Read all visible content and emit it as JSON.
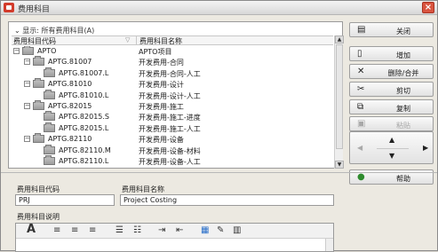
{
  "window": {
    "title": "费用科目",
    "close_glyph": "×"
  },
  "list": {
    "show_all": "⌄ 显示: 所有费用科目(A)",
    "col_code": "费用科目代码",
    "col_name": "费用科目名称",
    "rows": [
      {
        "exp": "−",
        "code": "APTO",
        "name": "APTO项目"
      },
      {
        "exp": "−",
        "code": "APTG.81007",
        "name": "开发费用-合同"
      },
      {
        "exp": "",
        "code": "APTG.81007.L",
        "name": "开发费用-合同-人工"
      },
      {
        "exp": "−",
        "code": "APTG.81010",
        "name": "开发费用-设计"
      },
      {
        "exp": "",
        "code": "APTG.81010.L",
        "name": "开发费用-设计-人工"
      },
      {
        "exp": "−",
        "code": "APTG.82015",
        "name": "开发费用-施工"
      },
      {
        "exp": "",
        "code": "APTG.82015.S",
        "name": "开发费用-施工-进度"
      },
      {
        "exp": "",
        "code": "APTG.82015.L",
        "name": "开发费用-施工-人工"
      },
      {
        "exp": "−",
        "code": "APTG.82110",
        "name": "开发费用-设备"
      },
      {
        "exp": "",
        "code": "APTG.82110.M",
        "name": "开发费用-设备-材料"
      },
      {
        "exp": "",
        "code": "APTG.82110.L",
        "name": "开发费用-设备-人工"
      }
    ]
  },
  "buttons": {
    "close": "关闭",
    "add": "增加",
    "delete_merge": "删除/合并",
    "cut": "剪切",
    "copy": "复制",
    "paste": "粘贴",
    "help": "帮助"
  },
  "form": {
    "code_label": "费用科目代码",
    "code_value": "PRJ",
    "name_label": "费用科目名称",
    "name_value": "Project Costing",
    "desc_label": "费用科目说明"
  },
  "colors": {
    "accent_red": "#d23b2b",
    "panel_bg": "#ece9e1"
  }
}
